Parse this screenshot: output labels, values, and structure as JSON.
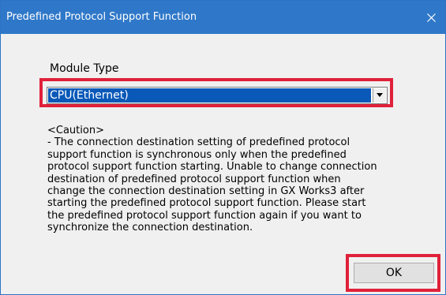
{
  "window": {
    "title": "Predefined Protocol Support Function",
    "close_icon": "close-icon"
  },
  "module_type": {
    "label": "Module Type",
    "selected_value": "CPU(Ethernet)",
    "dropdown_icon": "chevron-down-icon"
  },
  "caution": {
    "text": "<Caution>\n- The connection destination setting of predefined protocol\nsupport function is synchronous only when the predefined\nprotocol support function starting. Unable to change connection\ndestination of predefined protocol support function when\nchange the connection destination setting in GX Works3 after\nstarting the predefined protocol support function. Please start\nthe predefined protocol support function again if you want to\nsynchronize the connection destination."
  },
  "buttons": {
    "ok_label": "OK"
  },
  "colors": {
    "titlebar": "#2f78c9",
    "highlight": "#e0213a",
    "selection": "#0a59b8"
  }
}
